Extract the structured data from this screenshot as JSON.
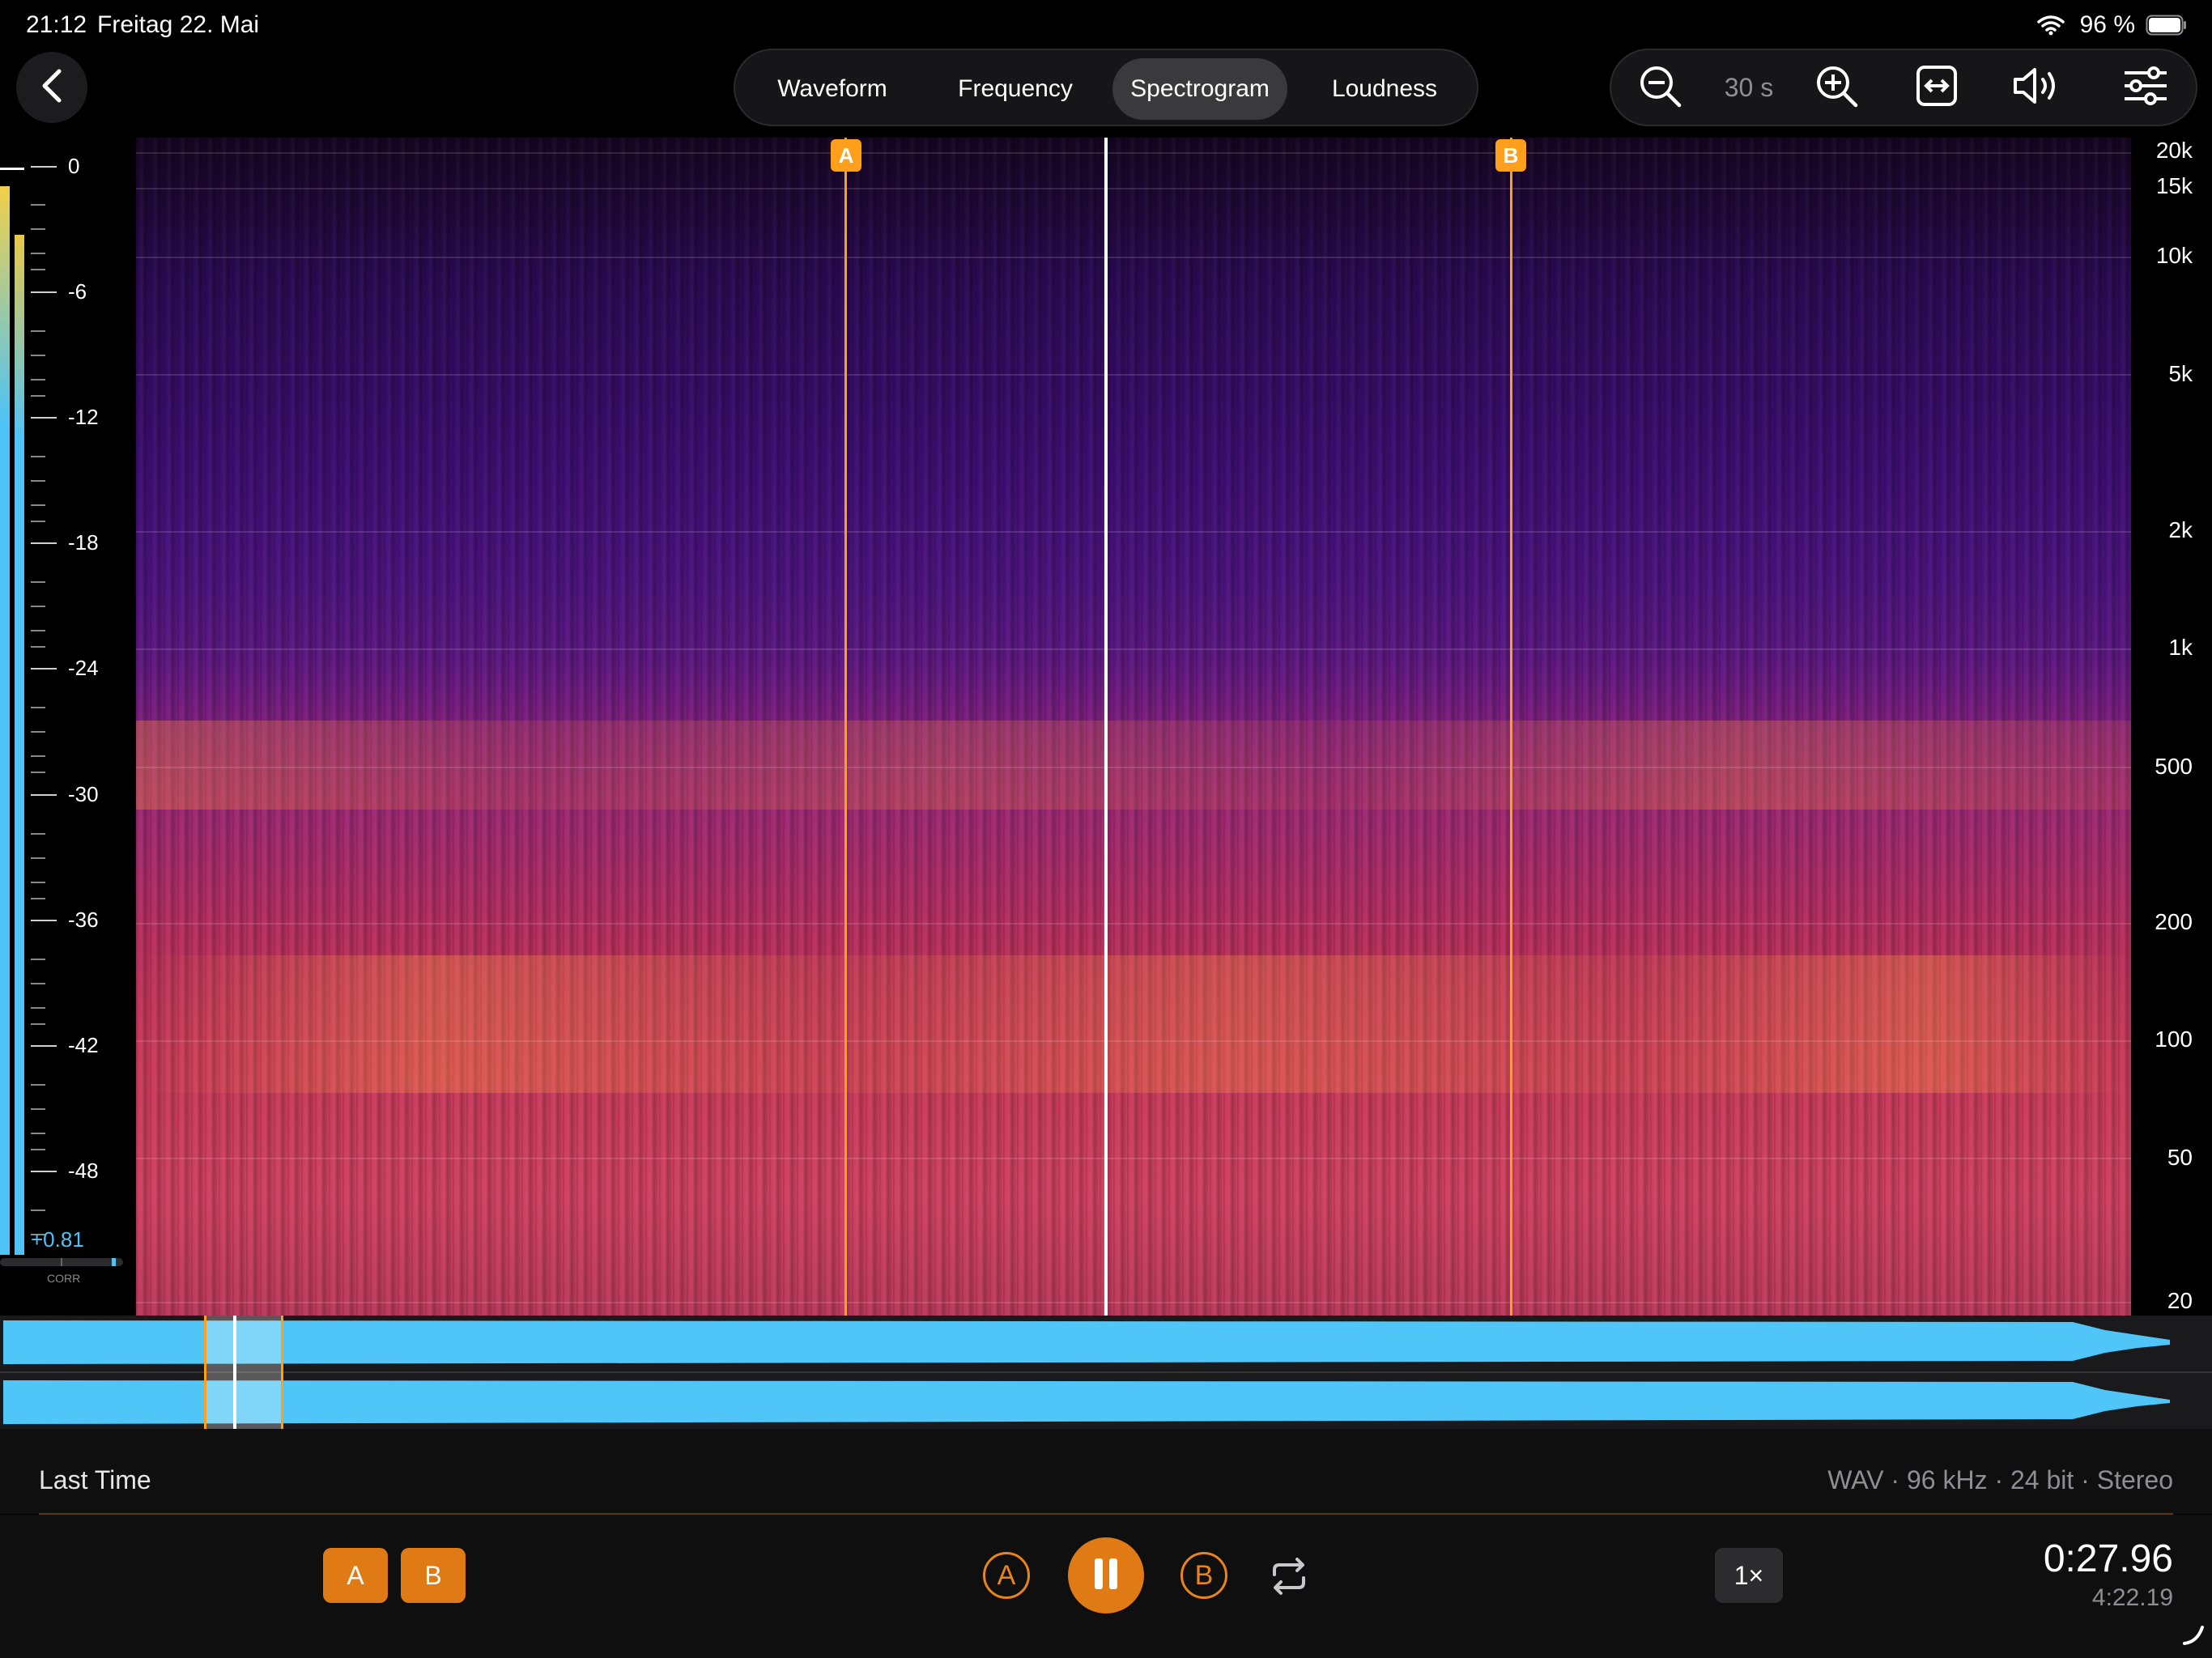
{
  "status_bar": {
    "time": "21:12",
    "date": "Freitag 22. Mai",
    "battery_percent": "96 %",
    "icons": [
      "wifi-icon",
      "battery-icon"
    ]
  },
  "tabs": [
    {
      "label": "Waveform",
      "active": false
    },
    {
      "label": "Frequency",
      "active": false
    },
    {
      "label": "Spectrogram",
      "active": true
    },
    {
      "label": "Loudness",
      "active": false
    }
  ],
  "toolbar": {
    "zoom_level": "30 s",
    "icons": [
      "zoom-out-icon",
      "zoom-in-icon",
      "fit-width-icon",
      "speaker-icon",
      "settings-sliders-icon"
    ]
  },
  "level_meter": {
    "db_labels": [
      "0",
      "-6",
      "-12",
      "-18",
      "-24",
      "-30",
      "-36",
      "-42",
      "-48"
    ],
    "correlation_value": "+0.81",
    "correlation_label": "CORR",
    "colors": {
      "meter": "#4fc3f7",
      "peak": "#f2d04a"
    }
  },
  "spectrogram": {
    "frequency_labels": [
      "20k",
      "15k",
      "10k",
      "5k",
      "2k",
      "1k",
      "500",
      "200",
      "100",
      "50",
      "20"
    ],
    "marker_a": "A",
    "marker_b": "B",
    "colors": {
      "marker": "#ff9f1c",
      "playhead": "#ffffff"
    }
  },
  "track": {
    "title": "Last Time",
    "format": "WAV · 96 kHz · 24 bit · Stereo"
  },
  "transport": {
    "set_a_label": "A",
    "set_b_label": "B",
    "jump_a_label": "A",
    "jump_b_label": "B",
    "speed": "1×",
    "current_time": "0:27.96",
    "total_time": "4:22.19",
    "colors": {
      "accent": "#e07a14"
    }
  }
}
